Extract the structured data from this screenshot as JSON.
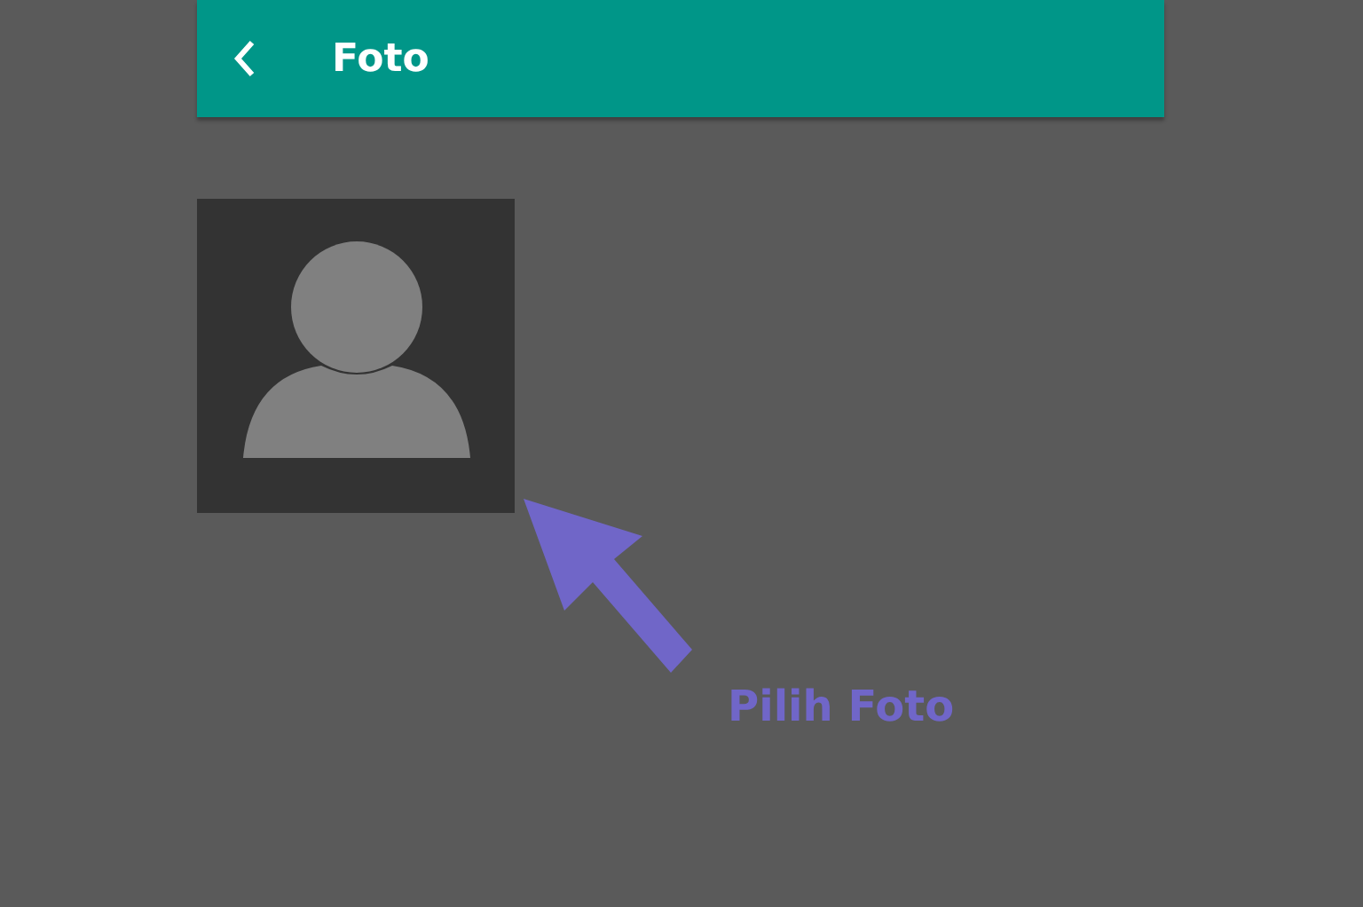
{
  "app_bar": {
    "title": "Foto"
  },
  "annotation": {
    "label": "Pilih Foto"
  }
}
